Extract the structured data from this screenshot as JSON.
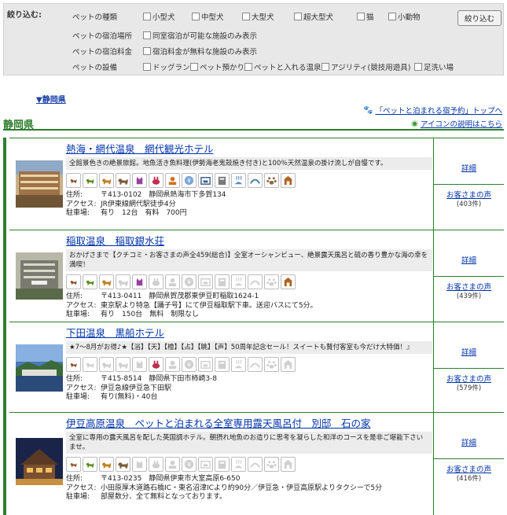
{
  "filter": {
    "label": "絞り込む:",
    "button": "絞り込む",
    "rows": [
      {
        "name": "ペットの種類",
        "options": [
          "小型犬",
          "中型犬",
          "大型犬",
          "超大型犬",
          "猫",
          "小動物"
        ]
      },
      {
        "name": "ペットの宿泊場所",
        "options": [
          "同室宿泊が可能な施設のみ表示"
        ]
      },
      {
        "name": "ペットの宿泊料金",
        "options": [
          "宿泊料金が無料な施設のみ表示"
        ]
      },
      {
        "name": "ペットの設備",
        "options": [
          "ドッグラン",
          "ペット預かり",
          "ペットと入れる温泉",
          "アジリティ(競技用遊具)",
          "足洗い場"
        ]
      }
    ]
  },
  "header": {
    "pref_link": "▼静岡県",
    "top_link": "「ペットと泊まれる宿予約」トップへ",
    "icon_link": "アイコンの説明はこちら",
    "pref_title": "静岡県"
  },
  "labels": {
    "address": "住所:",
    "access": "アクセス:",
    "parking": "駐車場:",
    "detail": "詳細",
    "voice": "お客さまの声"
  },
  "colors": {
    "accent_green": "#2e7d2e",
    "link_blue": "#0033aa",
    "active_icon": "#8b4a1a",
    "inactive_icon": "#cfcfcf"
  },
  "hotels": [
    {
      "name": "熱海・網代温泉　網代観光ホテル",
      "description": "全館景色きの絶景旅館。地魚活き魚料理(伊勢海老鬼殻焼き付き)と100％天然温泉の掛け流しが自慢です。",
      "address": "〒413-0102　静岡県熱海市下多賀134",
      "access": "JR伊東線網代駅徒歩4分",
      "parking": "有り　12台　有料　700円",
      "reviews": "(403件)",
      "icons": [
        "dog-s",
        "dog-m",
        "dog-l",
        "dog-xl",
        "cat",
        "small-animal",
        "room",
        "fee",
        "dogrun",
        "care",
        "spa",
        "agility",
        "footwash",
        "hotel"
      ],
      "active": [
        1,
        1,
        1,
        1,
        1,
        1,
        1,
        1,
        1,
        1,
        1,
        1,
        1,
        1
      ]
    },
    {
      "name": "稲取温泉　稲取銀水荘",
      "description": "おかげさまで【クチコミ・お客さまの声全459(総合)】全室オーシャンビュー、絶景露天風呂と硫の香り豊かな海の幸を満喫！",
      "address": "〒413-0411　静岡県賀茂郡東伊豆町稲取1624-1",
      "access": "東京駅より特急【踊子号】にて伊豆稲取駅下車。送迎バスにて5分。",
      "parking": "有り　150台　無料　制限なし",
      "reviews": "(439件)",
      "icons": [
        "dog-s",
        "dog-m",
        "dog-l",
        "dog-xl",
        "cat",
        "small-animal",
        "room",
        "fee",
        "dogrun",
        "care",
        "spa",
        "agility",
        "footwash",
        "hotel"
      ],
      "active": [
        1,
        1,
        1,
        0,
        1,
        0,
        0,
        0,
        0,
        0,
        0,
        0,
        0,
        1
      ]
    },
    {
      "name": "下田温泉　黒船ホテル",
      "description": "★7～8月がお得♪★【浴】【天】【檜】【占】【眺】【声】50周年記念セール！スイートも贅付客室も今だけ大特価！』",
      "address": "〒415-8514　静岡県下田市柿崎3-8",
      "access": "伊豆急線伊豆急下田駅",
      "parking": "有り(無料)・40台",
      "reviews": "(579件)",
      "icons": [
        "dog-s",
        "dog-m",
        "dog-l",
        "dog-xl",
        "cat",
        "small-animal",
        "room",
        "fee",
        "dogrun",
        "care",
        "spa",
        "agility",
        "footwash",
        "hotel"
      ],
      "active": [
        1,
        0,
        0,
        0,
        0,
        1,
        0,
        0,
        0,
        0,
        0,
        0,
        0,
        0
      ]
    },
    {
      "name": "伊豆高原温泉　ペットと泊まれる全室専用露天風呂付　別邸　石の家",
      "description": "全室に専用の露天風呂を配した英国調ホテル。朝摂れ地魚のお造りに思考を凝らした和洋のコースを是非ご堪能下さいませ。",
      "address": "〒413-0235　静岡県伊東市大室高原6-650",
      "access": "小田原厚木道路石橋IC・東名沼津ICより約90分／伊豆急・伊豆高原駅よりタクシーで5分",
      "parking": "部屋数分、全て無料となっております。",
      "reviews": "(416件)",
      "icons": [
        "dog-s",
        "dog-m",
        "dog-l",
        "dog-xl",
        "cat",
        "small-animal",
        "room",
        "fee",
        "dogrun",
        "care",
        "spa",
        "agility",
        "footwash",
        "hotel"
      ],
      "active": [
        1,
        1,
        1,
        1,
        0,
        0,
        0,
        0,
        0,
        0,
        0,
        0,
        0,
        0
      ]
    }
  ]
}
